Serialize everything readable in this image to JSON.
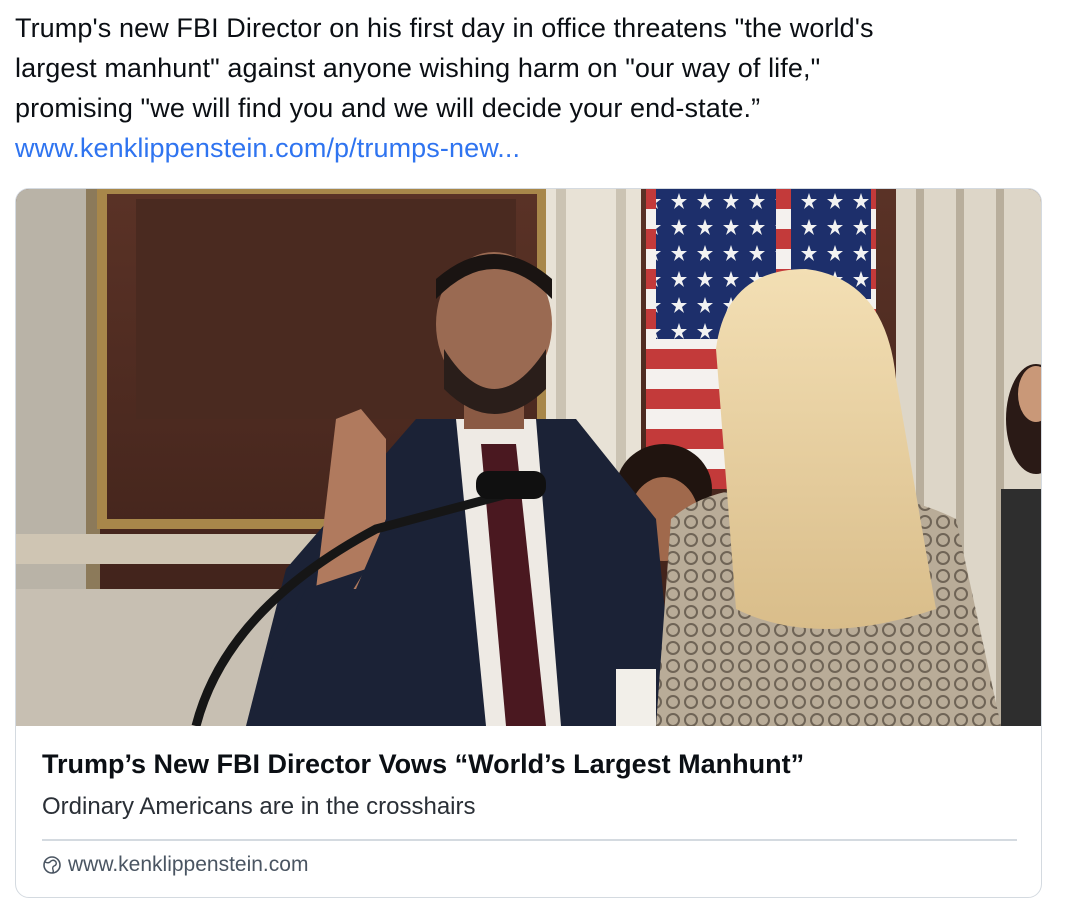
{
  "post": {
    "lines": [
      "Trump's new FBI Director on his first day in office threatens \"the world's",
      "largest manhunt\" against anyone wishing harm on \"our way of life,\"",
      "promising \"we will find you and we will decide your end-state.”"
    ],
    "link_text": "www.kenklippenstein.com/p/trumps-new..."
  },
  "card": {
    "title": "Trump’s New FBI Director Vows “World’s Largest Manhunt”",
    "description": "Ordinary Americans are in the crosshairs",
    "domain": "www.kenklippenstein.com",
    "domain_icon": "globe-icon",
    "image": "photo: man in dark suit raising right hand at swearing-in, microphone in front, blonde woman with back to camera, US flags in background"
  },
  "colors": {
    "link": "#2f74f0",
    "border": "#d4dae0",
    "text": "#0b0f14"
  }
}
